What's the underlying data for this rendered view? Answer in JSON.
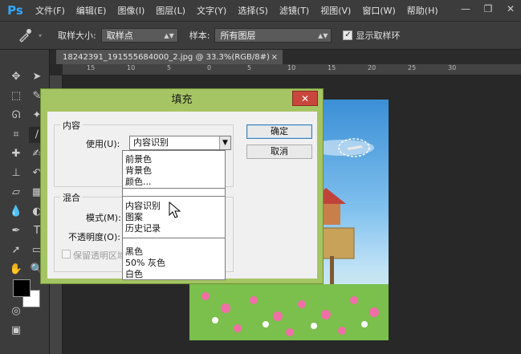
{
  "app": {
    "logo": "Ps"
  },
  "menu": [
    "文件(F)",
    "编辑(E)",
    "图像(I)",
    "图层(L)",
    "文字(Y)",
    "选择(S)",
    "滤镜(T)",
    "视图(V)",
    "窗口(W)",
    "帮助(H)"
  ],
  "window_controls": {
    "minimize": "—",
    "restore": "❐",
    "close": "✕"
  },
  "options": {
    "sample_size_label": "取样大小:",
    "sample_size_value": "取样点",
    "sample_label": "样本:",
    "sample_value": "所有图层",
    "show_ring_label": "显示取样环",
    "show_ring_checked": true
  },
  "document_tab": {
    "title": "18242391_191555684000_2.jpg @ 33.3%(RGB/8#)",
    "close": "×"
  },
  "ruler_h": [
    "15",
    "10",
    "5",
    "0",
    "5",
    "10",
    "15",
    "20",
    "25",
    "30"
  ],
  "dialog": {
    "title": "填充",
    "close": "✕",
    "content_group": "内容",
    "use_label": "使用(U):",
    "use_value": "内容识别",
    "ok": "确定",
    "cancel": "取消",
    "blend_group": "混合",
    "mode_label": "模式(M):",
    "opacity_label": "不透明度(O):",
    "preserve_label": "保留透明区域"
  },
  "dropdown_options": [
    {
      "label": "前景色"
    },
    {
      "label": "背景色"
    },
    {
      "label": "颜色..."
    },
    {
      "label": "内容识别"
    },
    {
      "label": "图案"
    },
    {
      "label": "历史记录"
    },
    {
      "label": "黑色"
    },
    {
      "label": "50% 灰色"
    },
    {
      "label": "白色"
    }
  ],
  "colors": {
    "dialog_frame": "#a5c463",
    "close_btn": "#c9463d",
    "ps_blue": "#31a8ff"
  }
}
